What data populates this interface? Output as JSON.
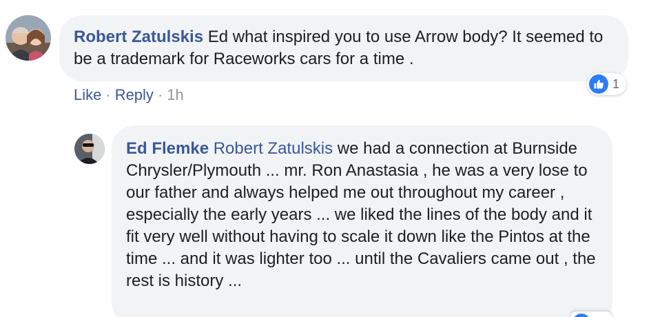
{
  "comment": {
    "author": "Robert Zatulskis",
    "text": " Ed what inspired you to use Arrow body? It seemed to be a trademark for Raceworks cars for a time .",
    "actions": {
      "like": "Like",
      "sep1": "·",
      "reply": "Reply",
      "sep2": "·",
      "time": "1h"
    },
    "reaction_count": "1"
  },
  "reply": {
    "author": "Ed Flemke",
    "mention": "Robert Zatulskis",
    "text": " we had a connection at Burnside Chrysler/Plymouth ... mr. Ron Anastasia , he was a very lose to our father and always helped me out throughout my career , especially the early years ... we liked the lines of the body and it fit very well without having to scale it down like the Pintos at the time ... and it was lighter too ... until the Cavaliers came out , the rest is history ..."
  },
  "colors": {
    "bubble": "#f2f3f5",
    "link": "#385898",
    "meta": "#90949c",
    "like_blue": "#2d7cf6"
  },
  "icons": {
    "reaction": "thumbs-up-icon"
  }
}
